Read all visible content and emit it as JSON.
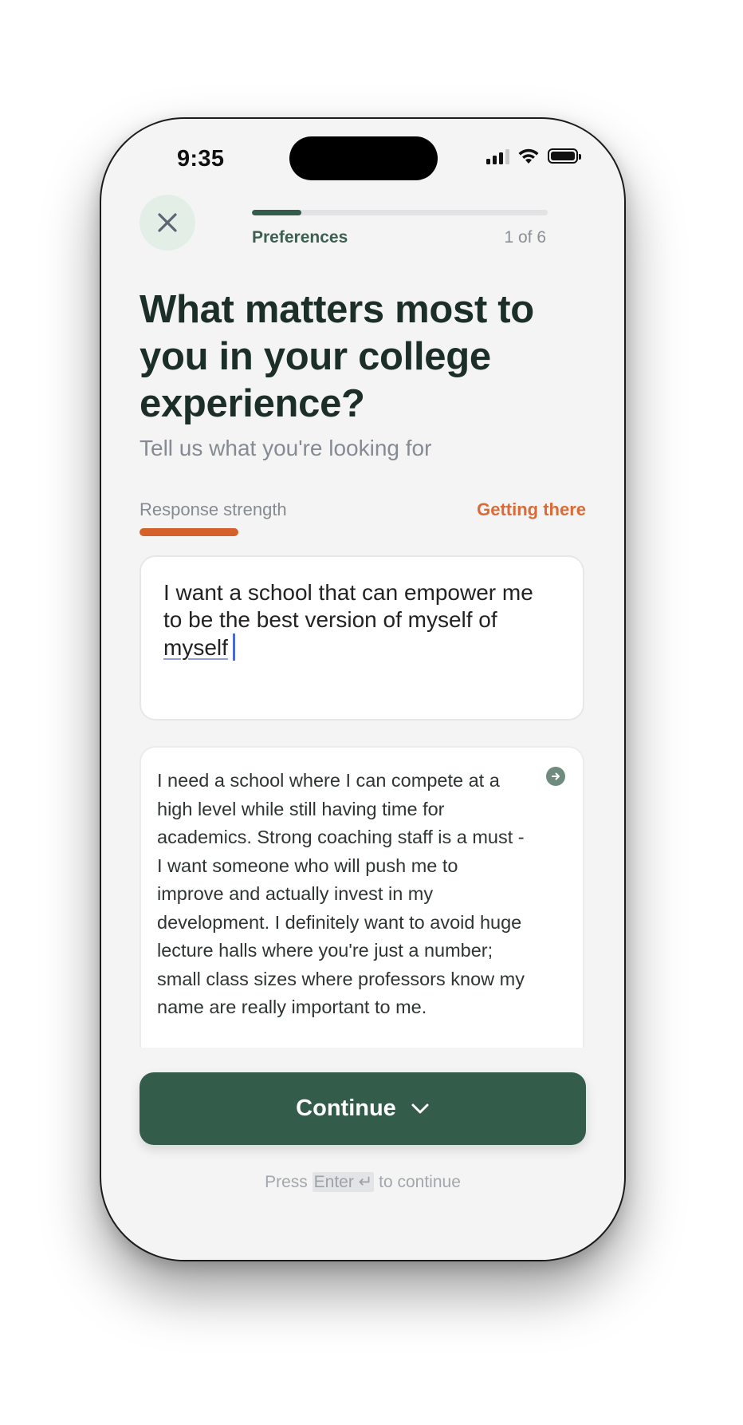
{
  "status_bar": {
    "time": "9:35"
  },
  "header": {
    "close_icon": "close-icon",
    "step_label": "Preferences",
    "step_count": "1 of 6",
    "progress_fraction": 0.1667,
    "progress_color": "#345c4b"
  },
  "question": {
    "title": "What matters most to you in your college experience?",
    "subtitle": "Tell us what you're looking for"
  },
  "strength": {
    "label": "Response strength",
    "status": "Getting there",
    "status_color": "#dd6a35"
  },
  "answer": {
    "line1": "I want a school that can empower me",
    "line2": "to be the best version of myself of",
    "line3": "myself"
  },
  "suggestion": {
    "text": "I need a school where I can compete at a high level while still having time for academics. Strong coaching staff is a must - I want someone who will push me to improve and actually invest in my development. I definitely want to avoid huge lecture halls where you're just a number; small class sizes where professors know my name are really important to me.",
    "action_icon": "arrow-right-circle-icon"
  },
  "footer": {
    "continue_label": "Continue",
    "continue_icon": "chevron-down-icon",
    "hint_before": "Press",
    "hint_key": "Enter ↵",
    "hint_after": "to continue",
    "button_color": "#345c4b"
  }
}
